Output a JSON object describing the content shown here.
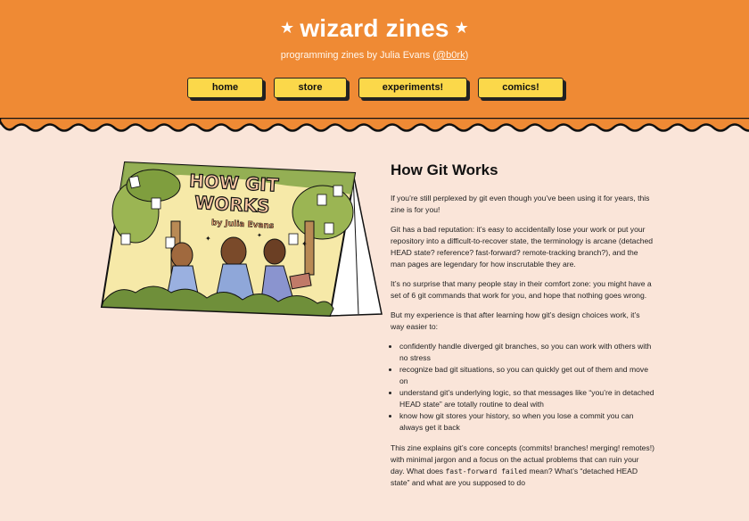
{
  "header": {
    "star_left": "★",
    "title": "wizard zines",
    "star_right": "★",
    "subtitle_prefix": "programming zines by Julia Evans (",
    "subtitle_handle": "@b0rk",
    "subtitle_suffix": ")",
    "bg_color": "#ef8a34"
  },
  "nav": [
    {
      "label": "home"
    },
    {
      "label": "store"
    },
    {
      "label": "experiments!"
    },
    {
      "label": "comics!"
    }
  ],
  "cover": {
    "title_line1": "HOW GIT",
    "title_line2": "WORKS",
    "author": "by Julia Evans"
  },
  "article": {
    "title": "How Git Works",
    "p1": "If you’re still perplexed by git even though you’ve been using it for years, this zine is for you!",
    "p2": "Git has a bad reputation: it’s easy to accidentally lose your work or put your repository into a difficult-to-recover state, the terminology is arcane (detached HEAD state? reference? fast-forward? remote-tracking branch?), and the man pages are legendary for how inscrutable they are.",
    "p3": "It’s no surprise that many people stay in their comfort zone: you might have a set of 6 git commands that work for you, and hope that nothing goes wrong.",
    "p4": "But my experience is that after learning how git’s design choices work, it’s way easier to:",
    "bullets": [
      "confidently handle diverged git branches, so you can work with others with no stress",
      "recognize bad git situations, so you can quickly get out of them and move on",
      "understand git’s underlying logic, so that messages like “you’re in detached HEAD state” are totally routine to deal with",
      "know how git stores your history, so when you lose a commit you can always get it back"
    ],
    "p5_a": "This zine explains git’s core concepts (commits! branches! merging! remotes!) with minimal jargon and a focus on the actual problems that can ruin your day. What does ",
    "p5_code": "fast-forward failed",
    "p5_b": " mean? What’s “detached HEAD state” and what are you supposed to do"
  }
}
